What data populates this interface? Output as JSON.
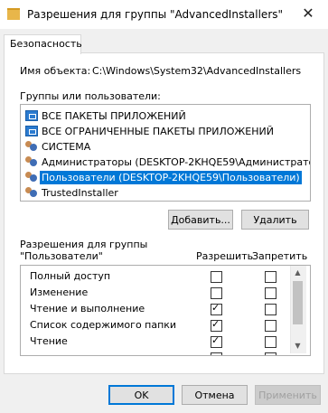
{
  "window": {
    "title": "Разрешения для группы \"AdvancedInstallers\""
  },
  "tabs": [
    {
      "label": "Безопасность"
    }
  ],
  "object": {
    "label": "Имя объекта:",
    "value": "C:\\Windows\\System32\\AdvancedInstallers"
  },
  "groups": {
    "label": "Группы или пользователи:",
    "items": [
      {
        "label": "ВСЕ ПАКЕТЫ ПРИЛОЖЕНИЙ",
        "icon": "package-icon"
      },
      {
        "label": "ВСЕ ОГРАНИЧЕННЫЕ ПАКЕТЫ ПРИЛОЖЕНИЙ",
        "icon": "package-icon"
      },
      {
        "label": "СИСТЕМА",
        "icon": "users-icon"
      },
      {
        "label": "Администраторы (DESKTOP-2KHQE59\\Администраторы)",
        "icon": "users-icon"
      },
      {
        "label": "Пользователи (DESKTOP-2KHQE59\\Пользователи)",
        "icon": "users-icon",
        "selected": true
      },
      {
        "label": "TrustedInstaller",
        "icon": "users-icon"
      }
    ]
  },
  "buttons": {
    "add": "Добавить...",
    "remove": "Удалить",
    "ok": "OK",
    "cancel": "Отмена",
    "apply": "Применить"
  },
  "permissions": {
    "label_line1": "Разрешения для группы",
    "label_line2": "\"Пользователи\"",
    "allow": "Разрешить",
    "deny": "Запретить",
    "rows": [
      {
        "name": "Полный доступ",
        "allow": false,
        "deny": false
      },
      {
        "name": "Изменение",
        "allow": false,
        "deny": false
      },
      {
        "name": "Чтение и выполнение",
        "allow": true,
        "deny": false
      },
      {
        "name": "Список содержимого папки",
        "allow": true,
        "deny": false
      },
      {
        "name": "Чтение",
        "allow": true,
        "deny": false
      },
      {
        "name": "",
        "allow": false,
        "deny": false
      }
    ]
  },
  "colors": {
    "selection": "#0078d7",
    "window_bg": "#f0f0f0"
  }
}
